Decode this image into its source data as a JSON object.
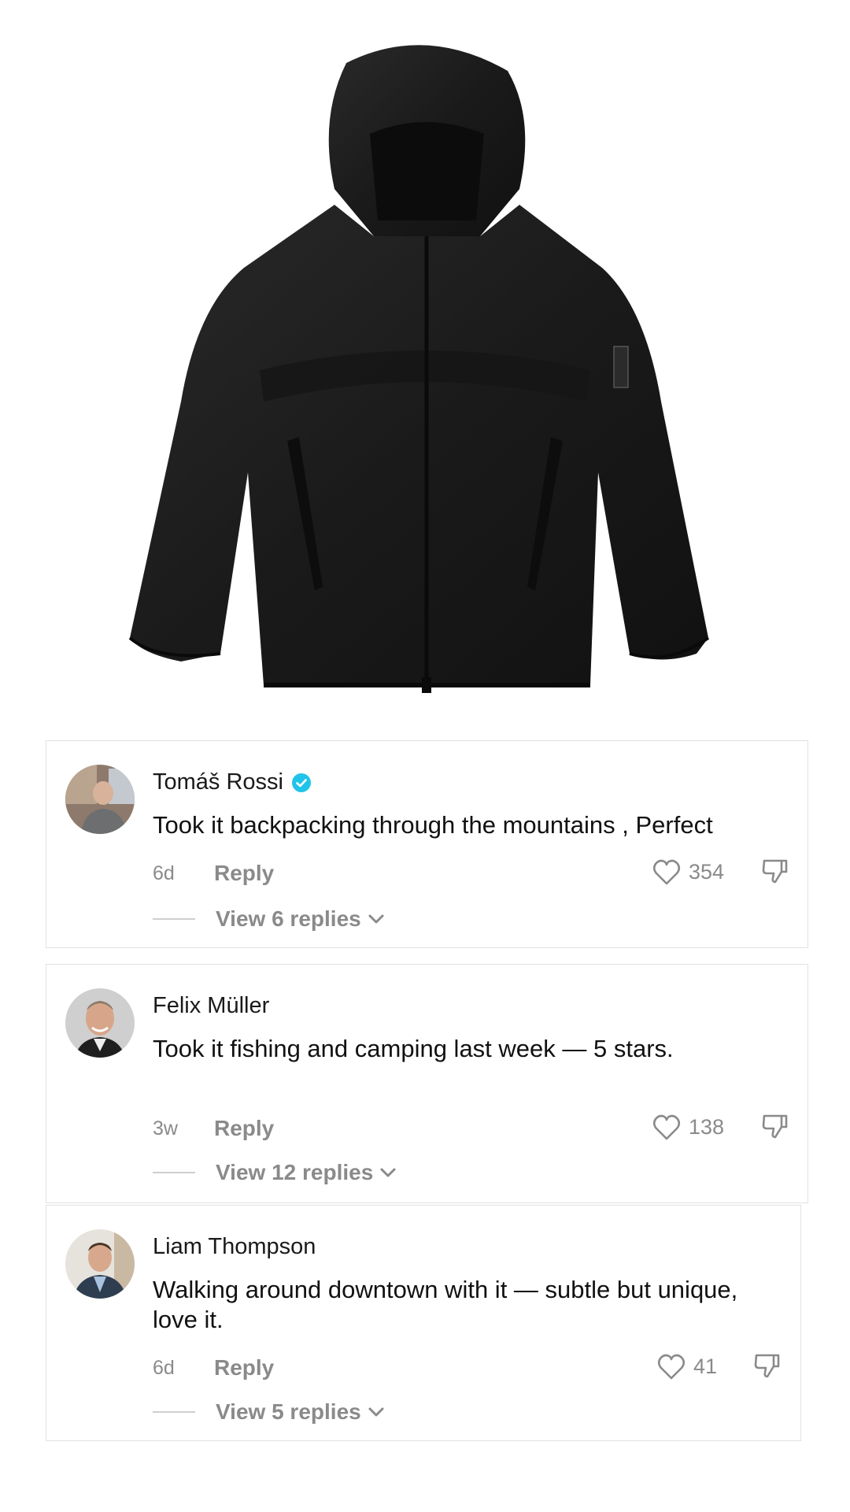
{
  "product": {
    "image_label": "black hooded jacket"
  },
  "comments": [
    {
      "name": "Tomáš Rossi",
      "verified": true,
      "text": "Took it backpacking through the mountains , Perfect",
      "time": "6d",
      "reply_label": "Reply",
      "likes": "354",
      "view_replies": "View 6 replies"
    },
    {
      "name": "Felix Müller",
      "verified": false,
      "text": "Took it fishing and camping last week — 5 stars.",
      "time": "3w",
      "reply_label": "Reply",
      "likes": "138",
      "view_replies": "View 12 replies"
    },
    {
      "name": "Liam Thompson",
      "verified": false,
      "text": "Walking around downtown with it — subtle but unique, love it.",
      "time": "6d",
      "reply_label": "Reply",
      "likes": "41",
      "view_replies": "View 5 replies"
    }
  ],
  "colors": {
    "verified_badge": "#20c4e8",
    "muted_text": "#8a8a8a",
    "card_border": "#e2e2e2",
    "jacket": "#1c1c1c"
  }
}
